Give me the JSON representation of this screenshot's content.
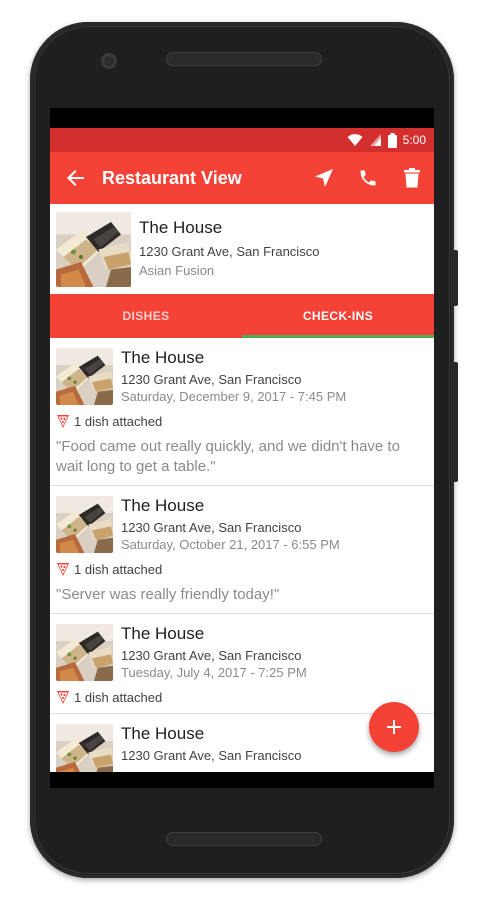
{
  "status_bar": {
    "time": "5:00"
  },
  "app_bar": {
    "title": "Restaurant View",
    "icons": [
      "back-arrow-icon",
      "navigation-icon",
      "phone-icon",
      "delete-icon"
    ]
  },
  "restaurant": {
    "name": "The House",
    "address": "1230 Grant Ave, San Francisco",
    "category": "Asian Fusion"
  },
  "tabs": [
    {
      "label": "DISHES",
      "active": false
    },
    {
      "label": "CHECK-INS",
      "active": true
    }
  ],
  "checkins": [
    {
      "name": "The House",
      "address": "1230 Grant Ave, San Francisco",
      "date": "Saturday, December 9, 2017 - 7:45 PM",
      "dishes": "1 dish attached",
      "quote": "\"Food came out really quickly, and we didn't have to wait long to get a table.\""
    },
    {
      "name": "The House",
      "address": "1230 Grant Ave, San Francisco",
      "date": "Saturday, October 21, 2017 - 6:55 PM",
      "dishes": "1 dish attached",
      "quote": "\"Server was really friendly today!\""
    },
    {
      "name": "The House",
      "address": "1230 Grant Ave, San Francisco",
      "date": "Tuesday, July 4, 2017 - 7:25 PM",
      "dishes": "1 dish attached",
      "quote": ""
    },
    {
      "name": "The House",
      "address": "1230 Grant Ave, San Francisco",
      "date": "",
      "dishes": "",
      "quote": ""
    }
  ],
  "fab": {
    "label": "+"
  },
  "colors": {
    "primary": "#f44336",
    "primary_dark": "#d32f2f",
    "tab_indicator": "#4caf50"
  }
}
